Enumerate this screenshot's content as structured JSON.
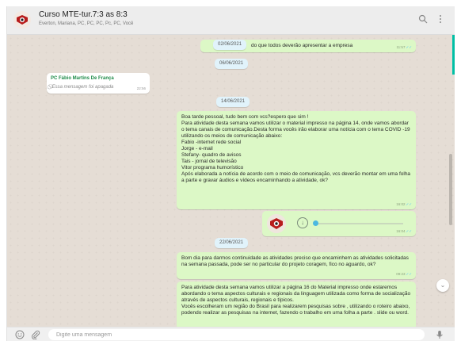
{
  "header": {
    "title": "Curso MTE-tur.7:3 as 8:3",
    "participants": "Everton, Mariana, PC, PC, PC, Pc, PC, Você"
  },
  "messages": {
    "m1_text": "do que todos deverão apresentar a empresa",
    "m1_time": "11:57",
    "m1_date": "02/06/2021",
    "date_06": "06/06/2021",
    "deleted_sender": "PC Fábio Martins De França",
    "deleted_text": "Essa mensagem foi apagada",
    "deleted_time": "22:56",
    "date_14": "14/06/2021",
    "long_text": "Boa tarde pessoal, tudo bem com vcs?espero que sim !\nPara atividade desta semana vamos utilizar o material impresso na página 14, onde vamos abordar o tema canais de comunicação.Desta forma vocês irão elaborar uma notícia  com o tema COVID -19 utilizando os meios de comunicação abaixo:\nFabio -internet rede social\nJorge - e-mail\nStefany- quadro de avisos\nTais - jornal de televisão\nVitor programa humorístico\nApós elaborada a notícia de acordo com o meio de comunicação, vcs deverão montar em uma folha a parte e gravar áudios e vídeos encaminhando a atividade, ok?",
    "long_time": "16:02",
    "audio_time": "16:04",
    "date_22": "22/06/2021",
    "m2_text": "Bom dia para darmos continuidade as atividades preciso que encaminhem as atividades solicitadas na semana passada, pode ser no particular do projeto coragem, fico no aguardo, ok?",
    "m2_time": "09:23",
    "m3_text": "Para atividade desta semana vamos utilizar a página 16 do Material impresso onde estaremos abordando o tema aspectos culturais e regionais da linguagem utilizada como forma de socialização através  de aspectos culturais, regionais e típicos.\nVocês escolheram um região do Brasil para realizarem pesquisas sobre , utilizando o roteiro abaixo, podendo realizar as pesquisas na internet, fazendo o trabalho em uma folha a parte . slide ou word."
  },
  "footer": {
    "placeholder": "Digite uma mensagem"
  },
  "icons": {
    "search": "search-icon",
    "menu": "more-vertical-icon",
    "emoji": "emoji-icon",
    "attach": "paperclip-icon",
    "mic": "microphone-icon",
    "read": "double-check-icon",
    "play": "play-icon",
    "scroll": "chevron-down-icon"
  },
  "colors": {
    "outgoing": "#dcf8c6",
    "incoming": "#ffffff",
    "chat_bg": "#e5ddd5",
    "read_ticks": "#4fc3f7",
    "accent": "#00bfa5"
  }
}
